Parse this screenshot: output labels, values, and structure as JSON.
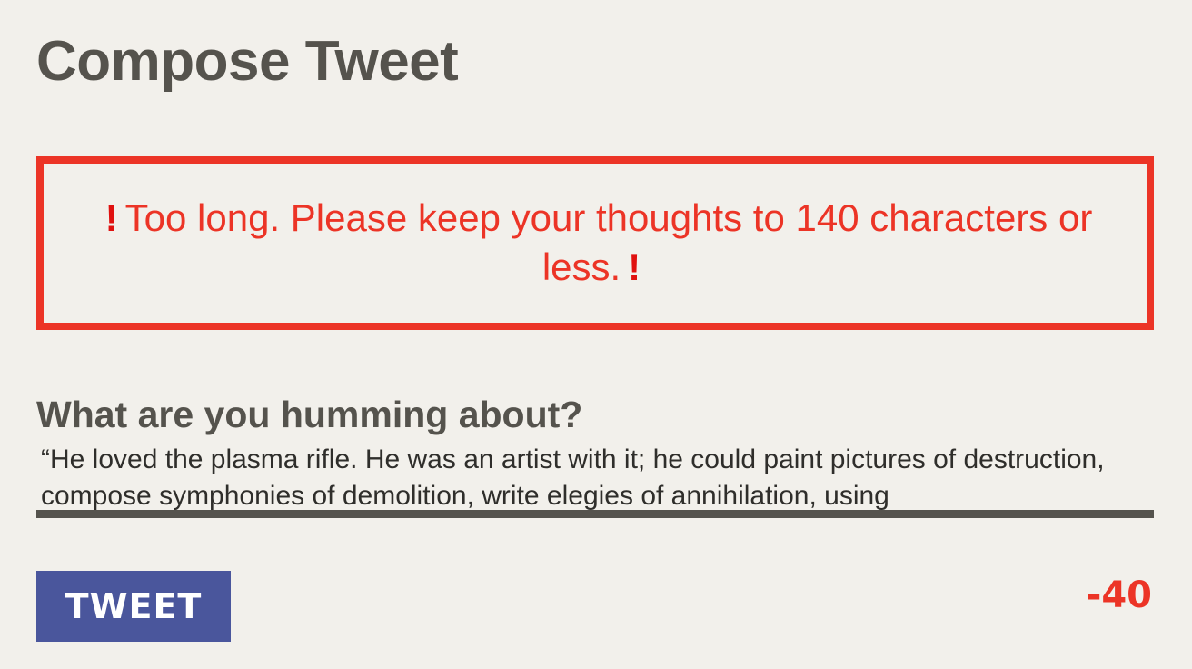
{
  "page": {
    "title": "Compose Tweet"
  },
  "error": {
    "icon": "exclamation-icon",
    "message": "Too long. Please keep your thoughts to 140 characters or less."
  },
  "compose": {
    "label": "What are you humming about?",
    "value": "“He loved the plasma rifle. He was an artist with it; he could paint pictures of destruction, compose symphonies of demolition, write elegies of annihilation, using"
  },
  "actions": {
    "tweet_label": "TWEET"
  },
  "counter": {
    "remaining": "-40"
  },
  "colors": {
    "background": "#f2f0eb",
    "text": "#55534d",
    "error": "#ec3426",
    "button": "#4a569c"
  }
}
